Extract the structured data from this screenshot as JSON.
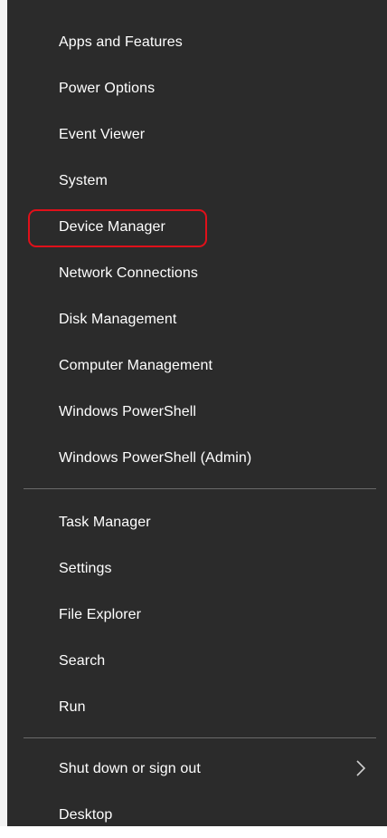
{
  "menu": {
    "group1": [
      {
        "label": "Apps and Features"
      },
      {
        "label": "Power Options"
      },
      {
        "label": "Event Viewer"
      },
      {
        "label": "System"
      },
      {
        "label": "Device Manager"
      },
      {
        "label": "Network Connections"
      },
      {
        "label": "Disk Management"
      },
      {
        "label": "Computer Management"
      },
      {
        "label": "Windows PowerShell"
      },
      {
        "label": "Windows PowerShell (Admin)"
      }
    ],
    "group2": [
      {
        "label": "Task Manager"
      },
      {
        "label": "Settings"
      },
      {
        "label": "File Explorer"
      },
      {
        "label": "Search"
      },
      {
        "label": "Run"
      }
    ],
    "group3": [
      {
        "label": "Shut down or sign out",
        "has_submenu": true,
        "icon": "chevron-right-icon"
      },
      {
        "label": "Desktop"
      }
    ]
  },
  "highlighted_item": "Device Manager",
  "colors": {
    "menu_background": "#2b2b2b",
    "text": "#ffffff",
    "separator": "#6a6a6a",
    "highlight_border": "#e0101a"
  }
}
